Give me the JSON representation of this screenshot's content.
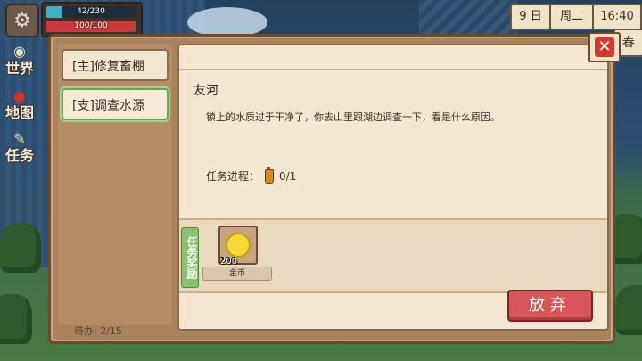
{
  "hud": {
    "hp_text": "42/230",
    "hp_fraction": 0.18,
    "stamina_text": "100/100",
    "stamina_fraction": 1.0,
    "day": "9 日",
    "weekday": "周二",
    "time": "16:40",
    "season": "春",
    "side_buttons": [
      {
        "label": "世界",
        "icon": "globe-icon"
      },
      {
        "label": "地图",
        "icon": "map-pin-icon"
      },
      {
        "label": "任务",
        "icon": "quest-scroll-icon"
      }
    ]
  },
  "quest_window": {
    "tabs": [
      {
        "label": "[主]修复畜棚",
        "active": false
      },
      {
        "label": "[支]调查水源",
        "active": true
      }
    ],
    "pending": "待办:  2/15",
    "detail": {
      "title": "友河",
      "description": "镇上的水质过于干净了，你去山里跟湖边调查一下，看是什么原因。",
      "progress_label": "任务进程：",
      "progress_value": "0/1",
      "progress_icon": "potion-bottle-icon"
    },
    "reward": {
      "label": "任务奖励",
      "items": [
        {
          "name": "金币",
          "quantity": "200",
          "icon": "gold-coin-icon"
        }
      ]
    },
    "abandon_label": "放弃",
    "close_icon": "close-icon"
  },
  "colors": {
    "abandon": "#d7565a",
    "close": "#d23a2f",
    "reward_label": "#8cc070",
    "hp": "#3fb0c8",
    "stamina": "#c93a3a"
  }
}
